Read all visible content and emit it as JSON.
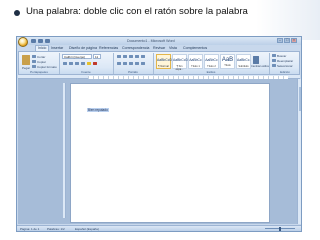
{
  "slide": {
    "title": "Una palabra: doble clic con el ratón sobre la palabra"
  },
  "window": {
    "title": "Documento1 - Microsoft Word",
    "tabs": [
      "Inicio",
      "Insertar",
      "Diseño de página",
      "Referencias",
      "Correspondencia",
      "Revisar",
      "Vista",
      "Complementos"
    ],
    "active_tab": "Inicio"
  },
  "ribbon": {
    "clipboard": {
      "label": "Portapapeles",
      "paste": "Pegar",
      "cut": "Cortar",
      "copy": "Copiar",
      "format_painter": "Copiar formato"
    },
    "font": {
      "label": "Fuente",
      "font_name": "Calibri (Cuerpo)",
      "font_size": "11"
    },
    "paragraph": {
      "label": "Párrafo"
    },
    "styles": {
      "label": "Estilos",
      "tiles": [
        {
          "sample": "AaBbCcDc",
          "name": "¶ Normal"
        },
        {
          "sample": "AaBbCcDc",
          "name": "¶ Sin espa..."
        },
        {
          "sample": "AaBbCc",
          "name": "Título 1"
        },
        {
          "sample": "AaBbCc",
          "name": "Título 2"
        },
        {
          "sample": "AaB",
          "name": "Título"
        },
        {
          "sample": "AaBbCc.",
          "name": "Subtítulo"
        }
      ],
      "change_styles": "Cambiar estilos"
    },
    "editing": {
      "label": "Edición",
      "find": "Buscar",
      "replace": "Reemplazar",
      "select": "Seleccionar"
    }
  },
  "document": {
    "selected_text": "Bien reputado"
  },
  "status": {
    "page": "Página: 1 de 1",
    "words": "Palabras: 1/2",
    "language": "Español (España)"
  }
}
